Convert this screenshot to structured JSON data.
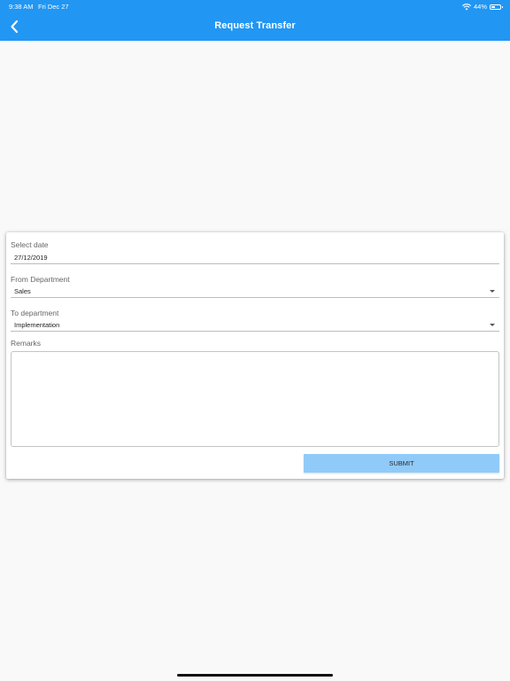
{
  "status_bar": {
    "time": "9:38 AM",
    "date": "Fri Dec 27",
    "battery": "44%",
    "battery_level": 0.44
  },
  "header": {
    "title": "Request Transfer",
    "back_icon": "chevron-left-icon",
    "color": "#2196f3"
  },
  "form": {
    "select_date": {
      "label": "Select date",
      "value": "27/12/2019"
    },
    "from_department": {
      "label": "From Department",
      "value": "Sales"
    },
    "to_department": {
      "label": "To department",
      "value": "Implementation"
    },
    "remarks": {
      "label": "Remarks",
      "value": ""
    },
    "submit_label": "SUBMIT",
    "submit_color": "#90caf9"
  }
}
